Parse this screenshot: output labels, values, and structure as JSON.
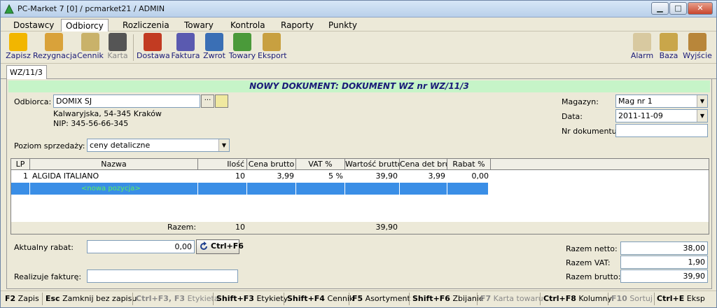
{
  "window": {
    "title": "PC-Market 7 [0] / pcmarket21 / ADMIN",
    "minimize": "▁",
    "maximize": "□",
    "close": "✕"
  },
  "menu": [
    "Dostawcy",
    "Odbiorcy",
    "Rozliczenia",
    "Towary",
    "Kontrola",
    "Raporty",
    "Punkty"
  ],
  "toolbar": {
    "left": [
      {
        "label": "Zapisz",
        "icon": "save-icon",
        "color": "#f2b600"
      },
      {
        "label": "Rezygnacja",
        "icon": "undo-icon",
        "color": "#d9a23a"
      },
      {
        "label": "Cennik",
        "icon": "price-list-icon",
        "color": "#c9b26a"
      },
      {
        "label": "Karta",
        "icon": "card-icon",
        "color": "#555555"
      },
      {
        "label": "Dostawa",
        "icon": "delivery-icon",
        "color": "#c23b22"
      },
      {
        "label": "Faktura",
        "icon": "invoice-icon",
        "color": "#5a5ab0"
      },
      {
        "label": "Zwrot",
        "icon": "return-icon",
        "color": "#3a6fb5"
      },
      {
        "label": "Towary",
        "icon": "goods-icon",
        "color": "#4a9a3a"
      },
      {
        "label": "Eksport",
        "icon": "export-icon",
        "color": "#c8a040"
      }
    ],
    "right": [
      {
        "label": "Alarm",
        "icon": "alarm-icon",
        "color": "#d8c9a0"
      },
      {
        "label": "Baza",
        "icon": "database-icon",
        "color": "#c9a64a"
      },
      {
        "label": "Wyjście",
        "icon": "exit-icon",
        "color": "#b8863a"
      }
    ]
  },
  "tab": {
    "label": "WZ/11/3"
  },
  "document": {
    "title": "NOWY DOKUMENT: DOKUMENT WZ nr WZ/11/3",
    "odbiorca_label": "Odbiorca:",
    "odbiorca_value": "DOMIX SJ",
    "ellipsis": "···",
    "address": "Kalwaryjska, 54-345 Kraków",
    "nip": "NIP: 345-56-66-345",
    "poziom_label": "Poziom sprzedaży:",
    "poziom_value": "ceny detaliczne",
    "magazyn_label": "Magazyn:",
    "magazyn_value": "Mag nr 1",
    "data_label": "Data:",
    "data_value": "2011-11-09",
    "nr_label": "Nr dokumentu:",
    "nr_value": ""
  },
  "grid": {
    "columns": [
      "LP",
      "Nazwa",
      "Ilość",
      "Cena brutto",
      "VAT %",
      "Wartość brutto",
      "Cena det brut",
      "Rabat %"
    ],
    "rows": [
      {
        "lp": "1",
        "nazwa": "ALGIDA ITALIANO",
        "ilosc": "10",
        "cena": "3,99",
        "vat": "5 %",
        "wartosc": "39,90",
        "cena_det": "3,99",
        "rabat": "0,00"
      }
    ],
    "new_row": "<nowa pozycja>",
    "sum_label": "Razem:",
    "sum_ilosc": "10",
    "sum_wartosc": "39,90"
  },
  "footer": {
    "rabat_label": "Aktualny rabat:",
    "rabat_value": "0,00",
    "ctrl_button": "Ctrl+F6",
    "faktura_label": "Realizuje fakturę:",
    "faktura_value": "",
    "netto_label": "Razem netto:",
    "netto_value": "38,00",
    "vat_label": "Razem VAT:",
    "vat_value": "1,90",
    "brutto_label": "Razem brutto:",
    "brutto_value": "39,90"
  },
  "statusbar": [
    {
      "key": "F2",
      "label": "Zapis",
      "enabled": true
    },
    {
      "key": "Esc",
      "label": "Zamknij bez zapisu",
      "enabled": true
    },
    {
      "key": "Ctrl+F3, F3",
      "label": "Etykieta",
      "enabled": false
    },
    {
      "key": "Shift+F3",
      "label": "Etykiety",
      "enabled": true
    },
    {
      "key": "Shift+F4",
      "label": "Cennik",
      "enabled": true
    },
    {
      "key": "F5",
      "label": "Asortyment",
      "enabled": true
    },
    {
      "key": "Shift+F6",
      "label": "Zbijanie",
      "enabled": true
    },
    {
      "key": "F7",
      "label": "Karta towaru",
      "enabled": false
    },
    {
      "key": "Ctrl+F8",
      "label": "Kolumny",
      "enabled": true
    },
    {
      "key": "F10",
      "label": "Sortuj",
      "enabled": false
    },
    {
      "key": "Ctrl+E",
      "label": "Eksp",
      "enabled": true
    }
  ]
}
